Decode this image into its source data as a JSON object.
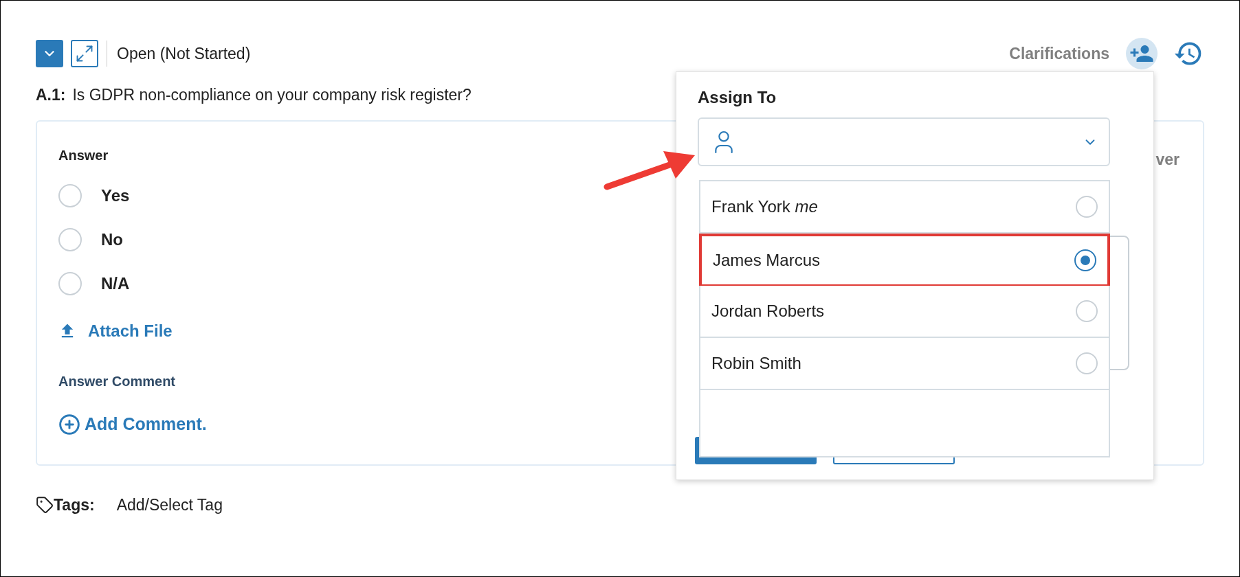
{
  "header": {
    "status": "Open (Not Started)",
    "clarifications_label": "Clarifications"
  },
  "question": {
    "number": "A.1:",
    "text": "Is GDPR non-compliance on your company risk register?"
  },
  "answer": {
    "label": "Answer",
    "options": [
      {
        "label": "Yes",
        "selected": false
      },
      {
        "label": "No",
        "selected": false
      },
      {
        "label": "N/A",
        "selected": false
      }
    ],
    "attach_label": "Attach File",
    "comment_label": "Answer Comment",
    "add_comment_label": "Add Comment."
  },
  "side_panel": {
    "partial_label": "ver"
  },
  "tags": {
    "label": "Tags:",
    "action": "Add/Select Tag"
  },
  "assign_popover": {
    "title": "Assign To",
    "people": [
      {
        "name": "Frank York *me*",
        "selected": false,
        "highlighted": false
      },
      {
        "name": "James Marcus",
        "selected": true,
        "highlighted": true
      },
      {
        "name": "Jordan Roberts",
        "selected": false,
        "highlighted": false
      },
      {
        "name": "Robin Smith",
        "selected": false,
        "highlighted": false
      }
    ]
  }
}
